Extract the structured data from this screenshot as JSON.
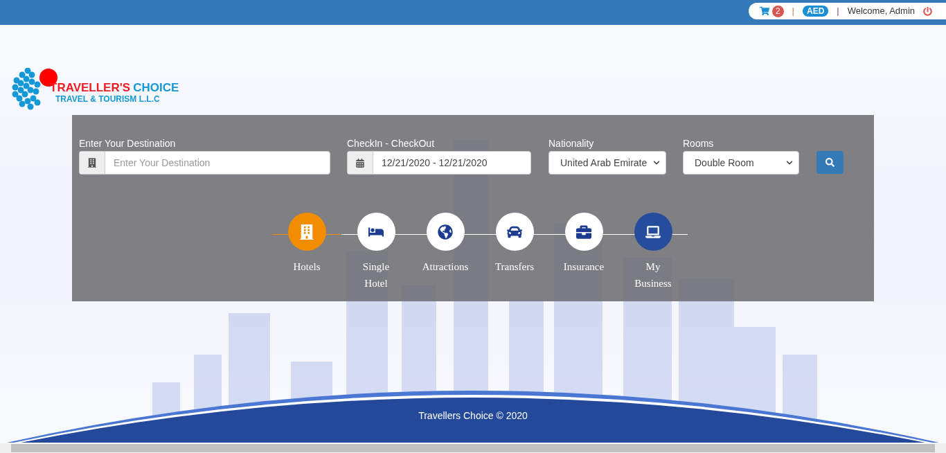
{
  "top_bar": {
    "cart_count": "2",
    "separator_1": "|",
    "currency": "AED",
    "separator_2": "|",
    "welcome": "Welcome, Admin"
  },
  "logo": {
    "title_part_1": "TRAVELLER'S",
    "title_part_2": "CHOICE",
    "subtitle": "TRAVEL & TOURISM L.L.C"
  },
  "search": {
    "destination": {
      "label": "Enter Your Destination",
      "placeholder": "Enter Your Destination"
    },
    "dates": {
      "label": "CheckIn - CheckOut",
      "value": "12/21/2020 - 12/21/2020"
    },
    "nationality": {
      "label": "Nationality",
      "value": "United Arab Emirate"
    },
    "rooms": {
      "label": "Rooms",
      "value": "Double Room"
    }
  },
  "services": [
    {
      "kind": "hotels",
      "label": "Hotels",
      "selected": true,
      "highlighted": false
    },
    {
      "kind": "bed",
      "label": "Single Hotel",
      "selected": false,
      "highlighted": false
    },
    {
      "kind": "globe",
      "label": "Attractions",
      "selected": false,
      "highlighted": false
    },
    {
      "kind": "car",
      "label": "Transfers",
      "selected": false,
      "highlighted": false
    },
    {
      "kind": "briefcase",
      "label": "Insurance",
      "selected": false,
      "highlighted": false
    },
    {
      "kind": "laptop",
      "label": "My Business",
      "selected": false,
      "highlighted": true
    }
  ],
  "footer": {
    "copyright": "Travellers Choice © 2020"
  }
}
